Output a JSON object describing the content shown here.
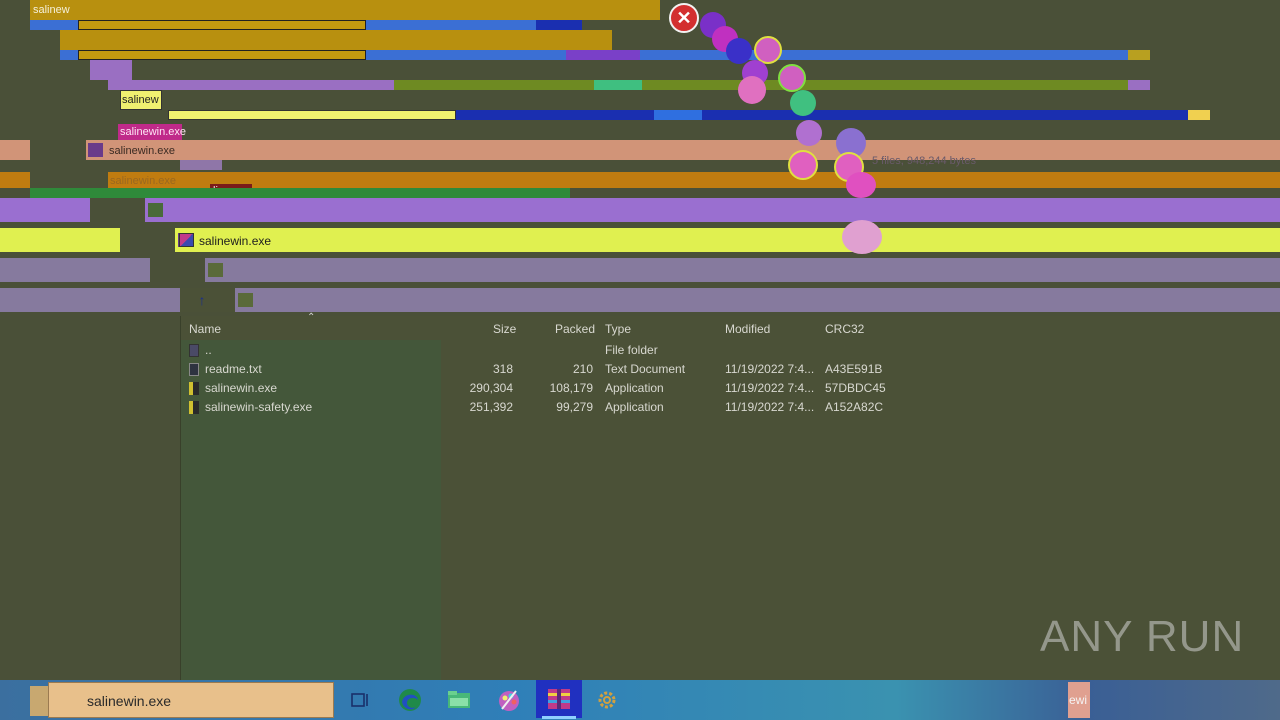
{
  "glitch_labels": {
    "l1": "salinew",
    "l2": "salinew",
    "l3": "salinewin.exe",
    "l4": "salinewin.exe",
    "l5": "salinewin.exe",
    "l6": "salinewin.exe",
    "l7": "linew"
  },
  "file_list": {
    "columns": {
      "name": "Name",
      "size": "Size",
      "packed": "Packed",
      "type": "Type",
      "modified": "Modified",
      "crc32": "CRC32"
    },
    "rows": [
      {
        "name": "..",
        "size": "",
        "packed": "",
        "type": "File folder",
        "modified": "",
        "crc32": ""
      },
      {
        "name": "readme.txt",
        "size": "318",
        "packed": "210",
        "type": "Text Document",
        "modified": "11/19/2022 7:4...",
        "crc32": "A43E591B"
      },
      {
        "name": "salinewin.exe",
        "size": "290,304",
        "packed": "108,179",
        "type": "Application",
        "modified": "11/19/2022 7:4...",
        "crc32": "57DBDC45"
      },
      {
        "name": "salinewin-safety.exe",
        "size": "251,392",
        "packed": "99,279",
        "type": "Application",
        "modified": "11/19/2022 7:4...",
        "crc32": "A152A82C"
      }
    ]
  },
  "status_fragment": "5 files, 948,244 bytes",
  "taskbar": {
    "search_value": "salinewin.exe",
    "icons": [
      "task-view-icon",
      "edge-icon",
      "file-explorer-icon",
      "paint-icon",
      "winrar-icon",
      "settings-icon"
    ],
    "right_fragment": "ewi"
  },
  "watermark": "ANY RUN",
  "colors": {
    "error_red": "#d32f2f",
    "taskbar_blue": "#2f7fb8",
    "search_fill": "#e8c08b"
  }
}
